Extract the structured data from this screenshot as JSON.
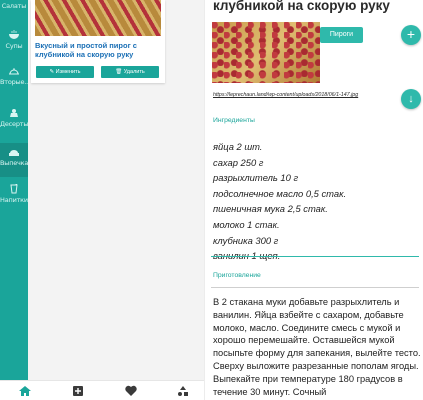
{
  "sidebar": {
    "items": [
      {
        "label": "Салаты",
        "icon": "salad-icon"
      },
      {
        "label": "Супы",
        "icon": "soup-icon"
      },
      {
        "label": "Вторые...",
        "icon": "main-dish-icon"
      },
      {
        "label": "Десерты",
        "icon": "dessert-icon"
      },
      {
        "label": "Выпечка",
        "icon": "baking-icon",
        "active": true
      },
      {
        "label": "Напитки",
        "icon": "drinks-icon"
      }
    ]
  },
  "card": {
    "title": "Вкусный и простой пирог с клубникой на скорую руку",
    "edit_label": "✎ Изменить",
    "delete_label": "🗑 Удалить"
  },
  "detail": {
    "title": "клубникой на скорую руку",
    "category_tag": "Пироги",
    "url": "https://leprechaun.land/wp-content/uploads/2018/06/1-147.jpg",
    "ingredients_header": "Ингредиенты",
    "ingredients": [
      "яйца 2 шт.",
      "сахар 250 г",
      "разрыхлитель 10 г",
      "подсолнечное масло 0,5 стак.",
      "пшеничная мука 2,5 стак.",
      "молоко 1 стак.",
      "клубника 300 г",
      "ванилин 1 щеп."
    ],
    "preparation_header": "Приготовление",
    "preparation": "В 2 стакана муки добавьте разрыхлитель и ванилин. Яйца взбейте с сахаром, добавьте молоко, масло. Соедините смесь с мукой и хорошо перемешайте. Оставшейся мукой посыпьте форму для запекания, вылейте тесто. Сверху выложите разрезанные пополам ягоды. Выпекайте при температуре 180 градусов в течение 30 минут. Сочный"
  },
  "bottom_nav": [
    {
      "icon": "home-icon"
    },
    {
      "icon": "add-recipe-icon"
    },
    {
      "icon": "heart-icon"
    },
    {
      "icon": "categories-icon"
    }
  ],
  "colors": {
    "accent": "#1aa59a",
    "title_link": "#1a6fb5"
  }
}
